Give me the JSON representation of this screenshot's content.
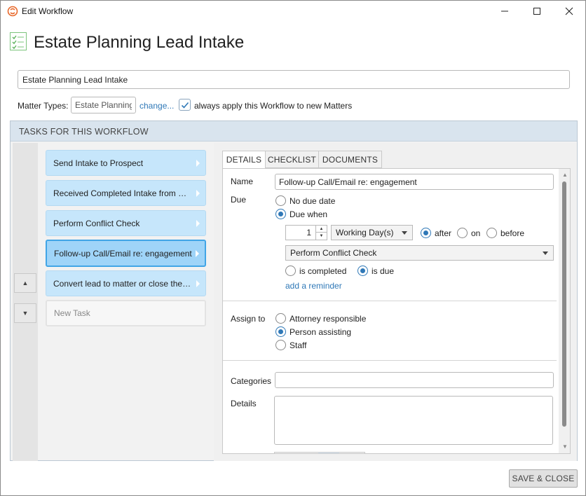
{
  "window": {
    "title": "Edit Workflow"
  },
  "header": {
    "title": "Estate Planning Lead Intake"
  },
  "form": {
    "name_value": "Estate Planning Lead Intake",
    "matter_types_label": "Matter Types:",
    "matter_types_value": "Estate Planning",
    "change_link": "change...",
    "always_apply_checked": true,
    "always_apply_label": "always apply this Workflow to new Matters"
  },
  "tasks": {
    "header": "TASKS FOR THIS WORKFLOW",
    "items": [
      {
        "label": "Send Intake to Prospect"
      },
      {
        "label": "Received Completed Intake from Prospect"
      },
      {
        "label": "Perform Conflict Check"
      },
      {
        "label": "Follow-up Call/Email re: engagement",
        "selected": true
      },
      {
        "label": "Convert lead to matter or close the lead"
      }
    ],
    "new_task": "New Task"
  },
  "tabs": [
    "DETAILS",
    "CHECKLIST",
    "DOCUMENTS"
  ],
  "details": {
    "name_label": "Name",
    "name_value": "Follow-up Call/Email re: engagement",
    "due_label": "Due",
    "no_due_date": "No due date",
    "due_when": "Due when",
    "due_mode": "due_when",
    "offset_value": "1",
    "unit_value": "Working Day(s)",
    "after": "after",
    "on": "on",
    "before": "before",
    "relation": "after",
    "related_task": "Perform Conflict Check",
    "is_completed": "is completed",
    "is_due": "is due",
    "trigger": "is_due",
    "add_reminder": "add a reminder",
    "assign_label": "Assign to",
    "assign_options": [
      "Attorney responsible",
      "Person assisting",
      "Staff"
    ],
    "assign_selected": "Person assisting",
    "categories_label": "Categories",
    "details_label": "Details"
  },
  "footer": {
    "save_close": "SAVE & CLOSE"
  },
  "colors": {
    "accent": "#2f78b7",
    "task_bg": "#c6e6fb",
    "task_selected_border": "#41a5e6",
    "header_band": "#d9e4ee",
    "brand_orange": "#e8692b"
  }
}
